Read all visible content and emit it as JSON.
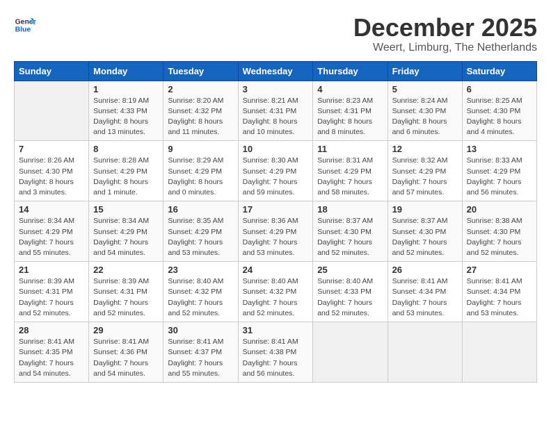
{
  "header": {
    "logo_line1": "General",
    "logo_line2": "Blue",
    "month_year": "December 2025",
    "location": "Weert, Limburg, The Netherlands"
  },
  "calendar": {
    "days_of_week": [
      "Sunday",
      "Monday",
      "Tuesday",
      "Wednesday",
      "Thursday",
      "Friday",
      "Saturday"
    ],
    "weeks": [
      [
        {
          "day": "",
          "info": ""
        },
        {
          "day": "1",
          "info": "Sunrise: 8:19 AM\nSunset: 4:33 PM\nDaylight: 8 hours\nand 13 minutes."
        },
        {
          "day": "2",
          "info": "Sunrise: 8:20 AM\nSunset: 4:32 PM\nDaylight: 8 hours\nand 11 minutes."
        },
        {
          "day": "3",
          "info": "Sunrise: 8:21 AM\nSunset: 4:31 PM\nDaylight: 8 hours\nand 10 minutes."
        },
        {
          "day": "4",
          "info": "Sunrise: 8:23 AM\nSunset: 4:31 PM\nDaylight: 8 hours\nand 8 minutes."
        },
        {
          "day": "5",
          "info": "Sunrise: 8:24 AM\nSunset: 4:30 PM\nDaylight: 8 hours\nand 6 minutes."
        },
        {
          "day": "6",
          "info": "Sunrise: 8:25 AM\nSunset: 4:30 PM\nDaylight: 8 hours\nand 4 minutes."
        }
      ],
      [
        {
          "day": "7",
          "info": "Sunrise: 8:26 AM\nSunset: 4:30 PM\nDaylight: 8 hours\nand 3 minutes."
        },
        {
          "day": "8",
          "info": "Sunrise: 8:28 AM\nSunset: 4:29 PM\nDaylight: 8 hours\nand 1 minute."
        },
        {
          "day": "9",
          "info": "Sunrise: 8:29 AM\nSunset: 4:29 PM\nDaylight: 8 hours\nand 0 minutes."
        },
        {
          "day": "10",
          "info": "Sunrise: 8:30 AM\nSunset: 4:29 PM\nDaylight: 7 hours\nand 59 minutes."
        },
        {
          "day": "11",
          "info": "Sunrise: 8:31 AM\nSunset: 4:29 PM\nDaylight: 7 hours\nand 58 minutes."
        },
        {
          "day": "12",
          "info": "Sunrise: 8:32 AM\nSunset: 4:29 PM\nDaylight: 7 hours\nand 57 minutes."
        },
        {
          "day": "13",
          "info": "Sunrise: 8:33 AM\nSunset: 4:29 PM\nDaylight: 7 hours\nand 56 minutes."
        }
      ],
      [
        {
          "day": "14",
          "info": "Sunrise: 8:34 AM\nSunset: 4:29 PM\nDaylight: 7 hours\nand 55 minutes."
        },
        {
          "day": "15",
          "info": "Sunrise: 8:34 AM\nSunset: 4:29 PM\nDaylight: 7 hours\nand 54 minutes."
        },
        {
          "day": "16",
          "info": "Sunrise: 8:35 AM\nSunset: 4:29 PM\nDaylight: 7 hours\nand 53 minutes."
        },
        {
          "day": "17",
          "info": "Sunrise: 8:36 AM\nSunset: 4:29 PM\nDaylight: 7 hours\nand 53 minutes."
        },
        {
          "day": "18",
          "info": "Sunrise: 8:37 AM\nSunset: 4:30 PM\nDaylight: 7 hours\nand 52 minutes."
        },
        {
          "day": "19",
          "info": "Sunrise: 8:37 AM\nSunset: 4:30 PM\nDaylight: 7 hours\nand 52 minutes."
        },
        {
          "day": "20",
          "info": "Sunrise: 8:38 AM\nSunset: 4:30 PM\nDaylight: 7 hours\nand 52 minutes."
        }
      ],
      [
        {
          "day": "21",
          "info": "Sunrise: 8:39 AM\nSunset: 4:31 PM\nDaylight: 7 hours\nand 52 minutes."
        },
        {
          "day": "22",
          "info": "Sunrise: 8:39 AM\nSunset: 4:31 PM\nDaylight: 7 hours\nand 52 minutes."
        },
        {
          "day": "23",
          "info": "Sunrise: 8:40 AM\nSunset: 4:32 PM\nDaylight: 7 hours\nand 52 minutes."
        },
        {
          "day": "24",
          "info": "Sunrise: 8:40 AM\nSunset: 4:32 PM\nDaylight: 7 hours\nand 52 minutes."
        },
        {
          "day": "25",
          "info": "Sunrise: 8:40 AM\nSunset: 4:33 PM\nDaylight: 7 hours\nand 52 minutes."
        },
        {
          "day": "26",
          "info": "Sunrise: 8:41 AM\nSunset: 4:34 PM\nDaylight: 7 hours\nand 53 minutes."
        },
        {
          "day": "27",
          "info": "Sunrise: 8:41 AM\nSunset: 4:34 PM\nDaylight: 7 hours\nand 53 minutes."
        }
      ],
      [
        {
          "day": "28",
          "info": "Sunrise: 8:41 AM\nSunset: 4:35 PM\nDaylight: 7 hours\nand 54 minutes."
        },
        {
          "day": "29",
          "info": "Sunrise: 8:41 AM\nSunset: 4:36 PM\nDaylight: 7 hours\nand 54 minutes."
        },
        {
          "day": "30",
          "info": "Sunrise: 8:41 AM\nSunset: 4:37 PM\nDaylight: 7 hours\nand 55 minutes."
        },
        {
          "day": "31",
          "info": "Sunrise: 8:41 AM\nSunset: 4:38 PM\nDaylight: 7 hours\nand 56 minutes."
        },
        {
          "day": "",
          "info": ""
        },
        {
          "day": "",
          "info": ""
        },
        {
          "day": "",
          "info": ""
        }
      ]
    ]
  }
}
